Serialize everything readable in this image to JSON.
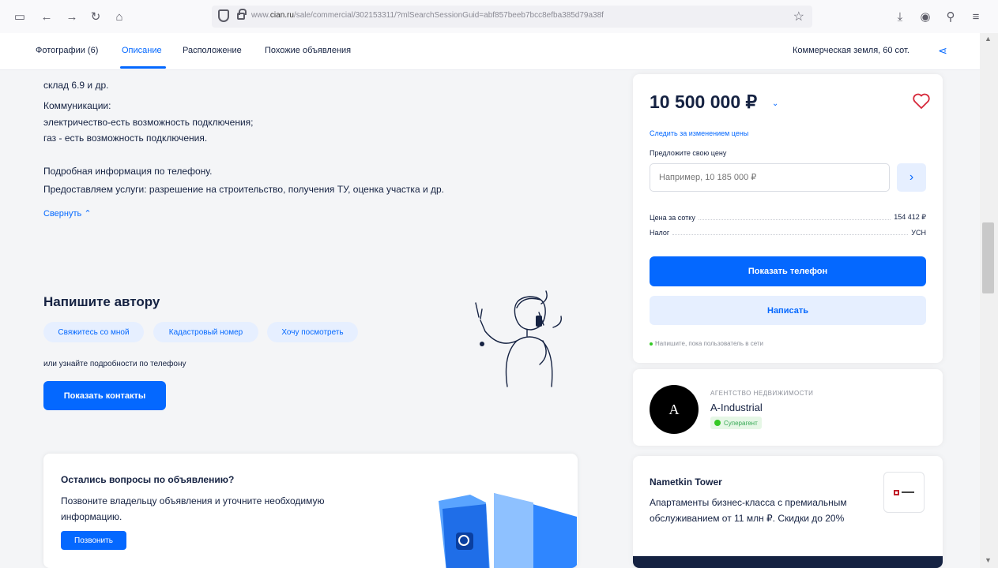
{
  "browser": {
    "url_prefix": "www.",
    "url_domain": "cian.ru",
    "url_rest": "/sale/commercial/302153311/?mlSearchSessionGuid=abf857beeb7bcc8efba385d79a38f",
    "icons": [
      "tab-icon",
      "back-icon",
      "forward-icon",
      "reload-icon",
      "home-icon",
      "shield-icon",
      "lock-icon",
      "bookmark-star-icon",
      "download-icon",
      "account-icon",
      "extensions-icon",
      "menu-icon"
    ]
  },
  "subnav": {
    "tabs": [
      "Фотографии (6)",
      "Описание",
      "Расположение",
      "Похожие объявления"
    ],
    "right_title": "Коммерческая земля, 60 сот."
  },
  "description": {
    "lines": [
      "склад 6.9 и др.",
      "Коммуникации:",
      "электричество-есть возможность подключения;",
      "газ - есть возможность подключения.",
      "Подробная информация по телефону.",
      "Предоставляем услуги: разрешение на строительство, получения ТУ, оценка участка и др."
    ],
    "collapse": "Свернуть"
  },
  "write_author": {
    "title": "Напишите автору",
    "chips": [
      "Свяжитесь со мной",
      "Кадастровый номер",
      "Хочу посмотреть"
    ],
    "or_phone": "или узнайте подробности по телефону",
    "contacts_button": "Показать контакты"
  },
  "questions": {
    "title": "Остались вопросы по объявлению?",
    "text": "Позвоните владельцу объявления и уточните необходимую информацию.",
    "button": "Позвонить"
  },
  "price_card": {
    "price": "10 500 000 ₽",
    "follow": "Следить за изменением цены",
    "offer_label": "Предложите свою цену",
    "offer_placeholder": "Например, 10 185 000 ₽",
    "rows": [
      {
        "label": "Цена за сотку",
        "value": "154 412 ₽"
      },
      {
        "label": "Налог",
        "value": "УСН"
      }
    ],
    "phone_button": "Показать телефон",
    "write_button": "Написать",
    "online_note": "Напишите, пока пользователь в сети"
  },
  "agency": {
    "type": "АГЕНТСТВО НЕДВИЖИМОСТИ",
    "name": "A-Industrial",
    "badge": "Суперагент"
  },
  "ad": {
    "title": "Nametkin Tower",
    "text": "Апартаменты бизнес-класса с премиальным обслуживанием от 11 млн ₽. Скидки до 20%"
  },
  "colors": {
    "accent": "#0468ff",
    "accent_light": "#e6efff",
    "text": "#152242",
    "badge_green": "#34c924"
  }
}
